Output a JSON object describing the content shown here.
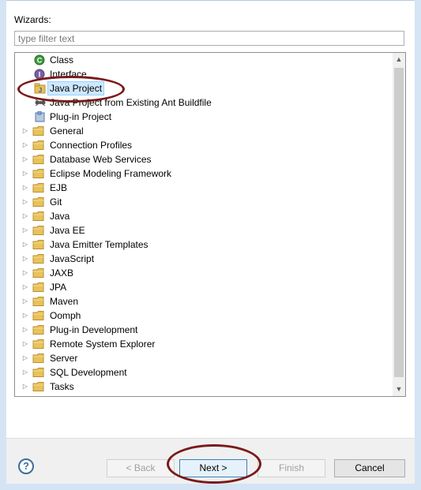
{
  "wizards_label": "Wizards:",
  "filter": {
    "placeholder": "type filter text",
    "value": ""
  },
  "tree": {
    "items": [
      {
        "label": "Class",
        "type": "leaf",
        "icon": "class-icon",
        "selected": false
      },
      {
        "label": "Interface",
        "type": "leaf",
        "icon": "interface-icon",
        "selected": false
      },
      {
        "label": "Java Project",
        "type": "leaf",
        "icon": "java-project-icon",
        "selected": true
      },
      {
        "label": "Java Project from Existing Ant Buildfile",
        "type": "leaf",
        "icon": "ant-icon",
        "selected": false
      },
      {
        "label": "Plug-in Project",
        "type": "leaf",
        "icon": "plugin-project-icon",
        "selected": false
      },
      {
        "label": "General",
        "type": "folder",
        "icon": "folder-icon",
        "selected": false
      },
      {
        "label": "Connection Profiles",
        "type": "folder",
        "icon": "folder-icon",
        "selected": false
      },
      {
        "label": "Database Web Services",
        "type": "folder",
        "icon": "folder-icon",
        "selected": false
      },
      {
        "label": "Eclipse Modeling Framework",
        "type": "folder",
        "icon": "folder-icon",
        "selected": false
      },
      {
        "label": "EJB",
        "type": "folder",
        "icon": "folder-icon",
        "selected": false
      },
      {
        "label": "Git",
        "type": "folder",
        "icon": "folder-icon",
        "selected": false
      },
      {
        "label": "Java",
        "type": "folder",
        "icon": "folder-icon",
        "selected": false
      },
      {
        "label": "Java EE",
        "type": "folder",
        "icon": "folder-icon",
        "selected": false
      },
      {
        "label": "Java Emitter Templates",
        "type": "folder",
        "icon": "folder-icon",
        "selected": false
      },
      {
        "label": "JavaScript",
        "type": "folder",
        "icon": "folder-icon",
        "selected": false
      },
      {
        "label": "JAXB",
        "type": "folder",
        "icon": "folder-icon",
        "selected": false
      },
      {
        "label": "JPA",
        "type": "folder",
        "icon": "folder-icon",
        "selected": false
      },
      {
        "label": "Maven",
        "type": "folder",
        "icon": "folder-icon",
        "selected": false
      },
      {
        "label": "Oomph",
        "type": "folder",
        "icon": "folder-icon",
        "selected": false
      },
      {
        "label": "Plug-in Development",
        "type": "folder",
        "icon": "folder-icon",
        "selected": false
      },
      {
        "label": "Remote System Explorer",
        "type": "folder",
        "icon": "folder-icon",
        "selected": false
      },
      {
        "label": "Server",
        "type": "folder",
        "icon": "folder-icon",
        "selected": false
      },
      {
        "label": "SQL Development",
        "type": "folder",
        "icon": "folder-icon",
        "selected": false
      },
      {
        "label": "Tasks",
        "type": "folder",
        "icon": "folder-icon",
        "selected": false
      }
    ]
  },
  "buttons": {
    "help_icon": "?",
    "back": "< Back",
    "next": "Next >",
    "finish": "Finish",
    "cancel": "Cancel"
  },
  "colors": {
    "folder": "#e8c25a",
    "selection": "#cde8ff",
    "annotation": "#7a1a1a"
  }
}
